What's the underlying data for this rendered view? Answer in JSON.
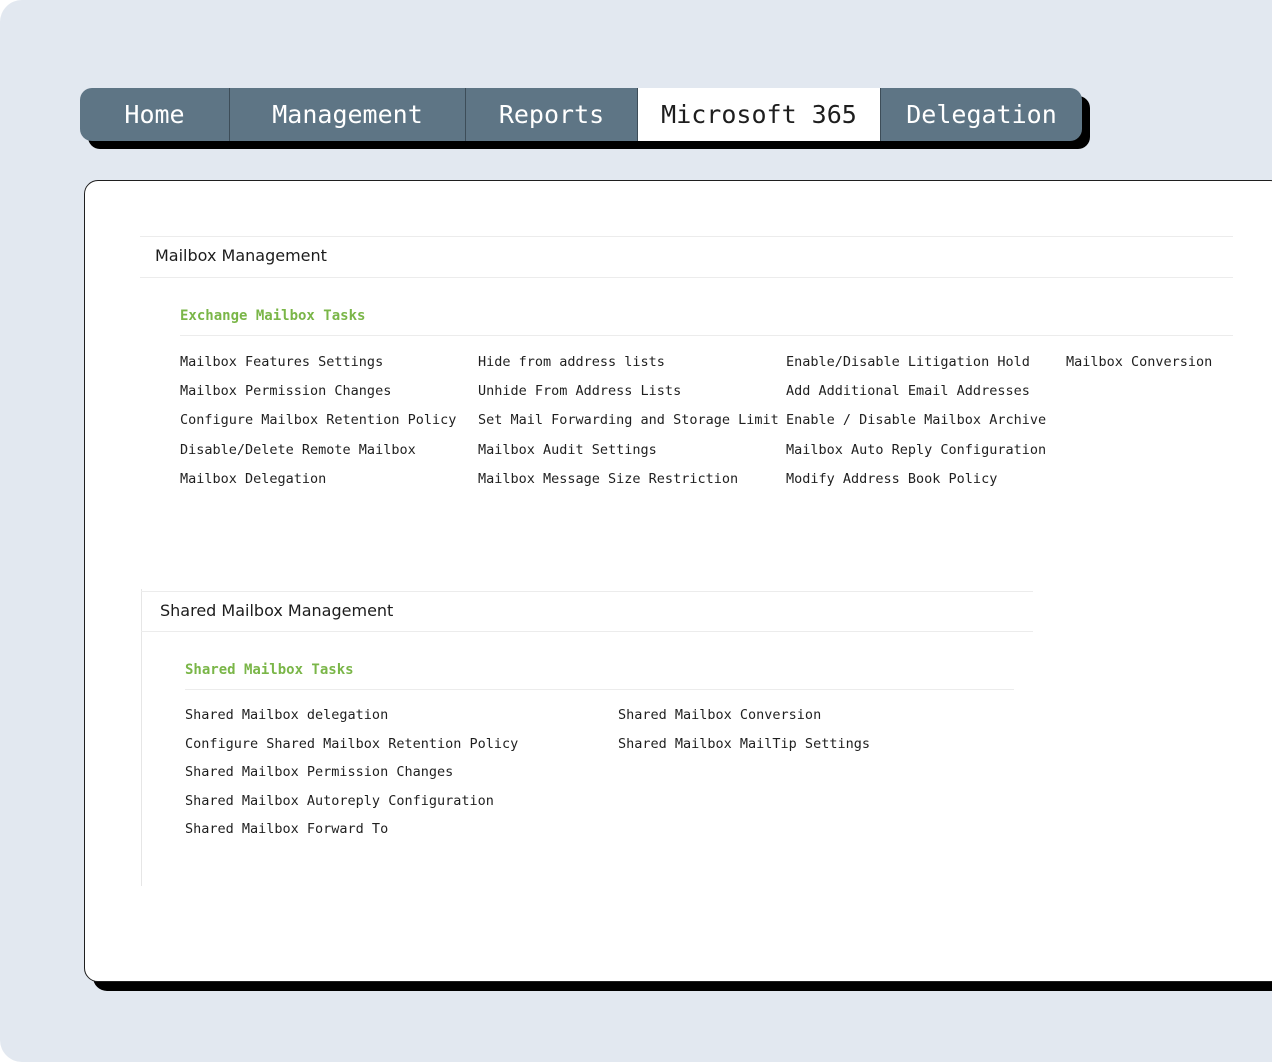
{
  "nav": {
    "tabs": [
      {
        "label": "Home"
      },
      {
        "label": "Management"
      },
      {
        "label": "Reports"
      },
      {
        "label": "Microsoft 365",
        "active": true
      },
      {
        "label": "Delegation"
      }
    ]
  },
  "mailbox_management": {
    "title": "Mailbox Management",
    "exchange_tasks": {
      "heading": "Exchange Mailbox Tasks",
      "columns": [
        [
          "Mailbox Features Settings",
          "Mailbox Permission Changes",
          "Configure Mailbox Retention Policy",
          "Disable/Delete Remote Mailbox",
          "Mailbox Delegation"
        ],
        [
          "Hide from address lists",
          "Unhide From Address Lists",
          "Set Mail Forwarding and Storage Limit",
          "Mailbox Audit Settings",
          "Mailbox Message Size Restriction"
        ],
        [
          "Enable/Disable Litigation Hold",
          "Add Additional Email Addresses",
          "Enable / Disable Mailbox Archive",
          "Mailbox Auto Reply Configuration",
          "Modify Address Book Policy"
        ],
        [
          "Mailbox Conversion"
        ]
      ]
    }
  },
  "shared_mailbox_management": {
    "title": "Shared Mailbox Management",
    "shared_tasks": {
      "heading": "Shared Mailbox Tasks",
      "columns": [
        [
          "Shared Mailbox delegation",
          "Configure Shared Mailbox Retention Policy",
          "Shared Mailbox Permission Changes",
          "Shared Mailbox Autoreply Configuration",
          "Shared Mailbox Forward To"
        ],
        [
          "Shared Mailbox Conversion",
          "Shared Mailbox MailTip Settings"
        ]
      ]
    }
  },
  "colors": {
    "nav_bg": "#5e7585",
    "active_tab_bg": "#ffffff",
    "subheading_green": "#7ab648",
    "page_bg": "#e2e8f0"
  }
}
